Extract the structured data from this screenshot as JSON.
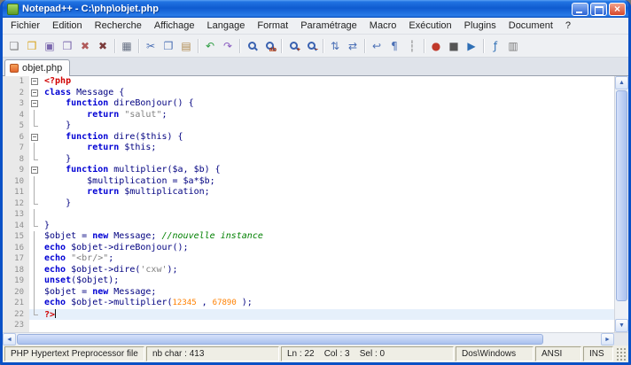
{
  "window": {
    "title": "Notepad++ - C:\\php\\objet.php",
    "buttons": [
      "minimize",
      "maximize",
      "close"
    ]
  },
  "menu": {
    "items": [
      "Fichier",
      "Edition",
      "Recherche",
      "Affichage",
      "Langage",
      "Format",
      "Paramétrage",
      "Macro",
      "Exécution",
      "Plugins",
      "Document",
      "?"
    ]
  },
  "toolbar": {
    "items": [
      {
        "name": "new-file-icon",
        "glyph": "❏",
        "color": "#7a7a7a"
      },
      {
        "name": "open-folder-icon",
        "glyph": "❒",
        "color": "#d8a219"
      },
      {
        "name": "save-icon",
        "glyph": "▣",
        "color": "#7b68ae"
      },
      {
        "name": "save-all-icon",
        "glyph": "❒",
        "color": "#7b68ae"
      },
      {
        "name": "close-file-icon",
        "glyph": "✖",
        "color": "#b05a5a"
      },
      {
        "name": "close-all-icon",
        "glyph": "✖",
        "color": "#7a3b3b"
      },
      {
        "sep": true
      },
      {
        "name": "print-icon",
        "glyph": "▦",
        "color": "#667083"
      },
      {
        "sep": true
      },
      {
        "name": "cut-icon",
        "glyph": "✂",
        "color": "#4a6fb5"
      },
      {
        "name": "copy-icon",
        "glyph": "❐",
        "color": "#4a6fb5"
      },
      {
        "name": "paste-icon",
        "glyph": "▤",
        "color": "#b08a4f"
      },
      {
        "sep": true
      },
      {
        "name": "undo-icon",
        "glyph": "↶",
        "color": "#2f9e44"
      },
      {
        "name": "redo-icon",
        "glyph": "↷",
        "color": "#8a5cc0"
      },
      {
        "sep": true
      },
      {
        "name": "find-icon",
        "kind": "mag"
      },
      {
        "name": "find-replace-icon",
        "kind": "mag",
        "badge": "ab"
      },
      {
        "sep": true
      },
      {
        "name": "zoom-in-icon",
        "kind": "mag",
        "badge": "+"
      },
      {
        "name": "zoom-out-icon",
        "kind": "mag",
        "badge": "−"
      },
      {
        "sep": true
      },
      {
        "name": "sync-vertical-scroll-icon",
        "glyph": "⇅",
        "color": "#4a6fb5"
      },
      {
        "name": "sync-horizontal-scroll-icon",
        "glyph": "⇄",
        "color": "#4a6fb5"
      },
      {
        "sep": true
      },
      {
        "name": "word-wrap-icon",
        "glyph": "↩",
        "color": "#4a6fb5"
      },
      {
        "name": "show-all-characters-icon",
        "glyph": "¶",
        "color": "#4a6fb5"
      },
      {
        "name": "indent-guide-icon",
        "glyph": "┆",
        "color": "#7a7a7a"
      },
      {
        "sep": true
      },
      {
        "name": "record-macro-icon",
        "glyph": "●",
        "color": "#c0392b"
      },
      {
        "name": "stop-record-icon",
        "glyph": "■",
        "color": "#555555"
      },
      {
        "name": "play-macro-icon",
        "glyph": "▶",
        "color": "#2f6fb5"
      },
      {
        "sep": true
      },
      {
        "name": "function-list-icon",
        "glyph": "ƒ",
        "color": "#2f6fb5"
      },
      {
        "name": "document-map-icon",
        "glyph": "▥",
        "color": "#7a7a7a"
      }
    ]
  },
  "tabs": [
    {
      "label": "objet.php",
      "active": true,
      "state": "modified"
    }
  ],
  "editor": {
    "current_line": 22,
    "lines": [
      {
        "n": 1,
        "fold": "box",
        "tokens": [
          {
            "t": "<?php",
            "c": "tag"
          }
        ]
      },
      {
        "n": 2,
        "fold": "box",
        "tokens": [
          {
            "t": "class",
            "c": "kw"
          },
          {
            "t": " Message {",
            "c": "d"
          }
        ]
      },
      {
        "n": 3,
        "fold": "box",
        "tokens": [
          {
            "t": "    ",
            "c": "d"
          },
          {
            "t": "function",
            "c": "kw"
          },
          {
            "t": " direBonjour() {",
            "c": "d"
          }
        ]
      },
      {
        "n": 4,
        "fold": "line",
        "tokens": [
          {
            "t": "        ",
            "c": "d"
          },
          {
            "t": "return",
            "c": "kw"
          },
          {
            "t": " ",
            "c": "d"
          },
          {
            "t": "\"salut\"",
            "c": "str"
          },
          {
            "t": ";",
            "c": "d"
          }
        ]
      },
      {
        "n": 5,
        "fold": "end",
        "tokens": [
          {
            "t": "    }",
            "c": "d"
          }
        ]
      },
      {
        "n": 6,
        "fold": "box",
        "tokens": [
          {
            "t": "    ",
            "c": "d"
          },
          {
            "t": "function",
            "c": "kw"
          },
          {
            "t": " dire($this) {",
            "c": "d"
          }
        ]
      },
      {
        "n": 7,
        "fold": "line",
        "tokens": [
          {
            "t": "        ",
            "c": "d"
          },
          {
            "t": "return",
            "c": "kw"
          },
          {
            "t": " $this;",
            "c": "d"
          }
        ]
      },
      {
        "n": 8,
        "fold": "end",
        "tokens": [
          {
            "t": "    }",
            "c": "d"
          }
        ]
      },
      {
        "n": 9,
        "fold": "box",
        "tokens": [
          {
            "t": "    ",
            "c": "d"
          },
          {
            "t": "function",
            "c": "kw"
          },
          {
            "t": " multiplier($a, $b) {",
            "c": "d"
          }
        ]
      },
      {
        "n": 10,
        "fold": "line",
        "tokens": [
          {
            "t": "        $multiplication = $a*$b;",
            "c": "d"
          }
        ]
      },
      {
        "n": 11,
        "fold": "line",
        "tokens": [
          {
            "t": "        ",
            "c": "d"
          },
          {
            "t": "return",
            "c": "kw"
          },
          {
            "t": " $multiplication;",
            "c": "d"
          }
        ]
      },
      {
        "n": 12,
        "fold": "end",
        "tokens": [
          {
            "t": "    }",
            "c": "d"
          }
        ]
      },
      {
        "n": 13,
        "fold": "line",
        "tokens": []
      },
      {
        "n": 14,
        "fold": "end",
        "tokens": [
          {
            "t": "}",
            "c": "d"
          }
        ]
      },
      {
        "n": 15,
        "fold": "line",
        "tokens": [
          {
            "t": "$objet = ",
            "c": "d"
          },
          {
            "t": "new",
            "c": "kw"
          },
          {
            "t": " Message; ",
            "c": "d"
          },
          {
            "t": "//nouvelle instance",
            "c": "com"
          }
        ]
      },
      {
        "n": 16,
        "fold": "line",
        "tokens": [
          {
            "t": "echo",
            "c": "kw"
          },
          {
            "t": " $objet->direBonjour();",
            "c": "d"
          }
        ]
      },
      {
        "n": 17,
        "fold": "line",
        "tokens": [
          {
            "t": "echo",
            "c": "kw"
          },
          {
            "t": " ",
            "c": "d"
          },
          {
            "t": "\"<br/>\"",
            "c": "str"
          },
          {
            "t": ";",
            "c": "d"
          }
        ]
      },
      {
        "n": 18,
        "fold": "line",
        "tokens": [
          {
            "t": "echo",
            "c": "kw"
          },
          {
            "t": " $objet->dire(",
            "c": "d"
          },
          {
            "t": "'cxw'",
            "c": "str"
          },
          {
            "t": ");",
            "c": "d"
          }
        ]
      },
      {
        "n": 19,
        "fold": "line",
        "tokens": [
          {
            "t": "unset",
            "c": "kw"
          },
          {
            "t": "($objet);",
            "c": "d"
          }
        ]
      },
      {
        "n": 20,
        "fold": "line",
        "tokens": [
          {
            "t": "$objet = ",
            "c": "d"
          },
          {
            "t": "new",
            "c": "kw"
          },
          {
            "t": " Message;",
            "c": "d"
          }
        ]
      },
      {
        "n": 21,
        "fold": "line",
        "tokens": [
          {
            "t": "echo",
            "c": "kw"
          },
          {
            "t": " $objet->multiplier(",
            "c": "d"
          },
          {
            "t": "12345",
            "c": "num"
          },
          {
            "t": ", ",
            "c": "d"
          },
          {
            "t": "67890",
            "c": "num"
          },
          {
            "t": ");",
            "c": "d"
          }
        ]
      },
      {
        "n": 22,
        "fold": "end",
        "tokens": [
          {
            "t": "?>",
            "c": "tag"
          }
        ]
      },
      {
        "n": 23,
        "fold": "",
        "tokens": []
      }
    ]
  },
  "statusbar": {
    "doc_type": "PHP Hypertext Preprocessor file",
    "length": "nb char : 413",
    "position": "Ln : 22    Col : 3    Sel : 0",
    "eol": "Dos\\Windows",
    "encoding": "ANSI",
    "mode": "INS"
  },
  "colors": {
    "default": "#000080",
    "keyword": "#0000d4",
    "string": "#808080",
    "comment": "#008000",
    "number": "#ff8000",
    "tag": "#d00000",
    "current_line": "#e6f0fb",
    "line_number": "#8e8e8e",
    "margin_bg": "#e9e9e9"
  }
}
